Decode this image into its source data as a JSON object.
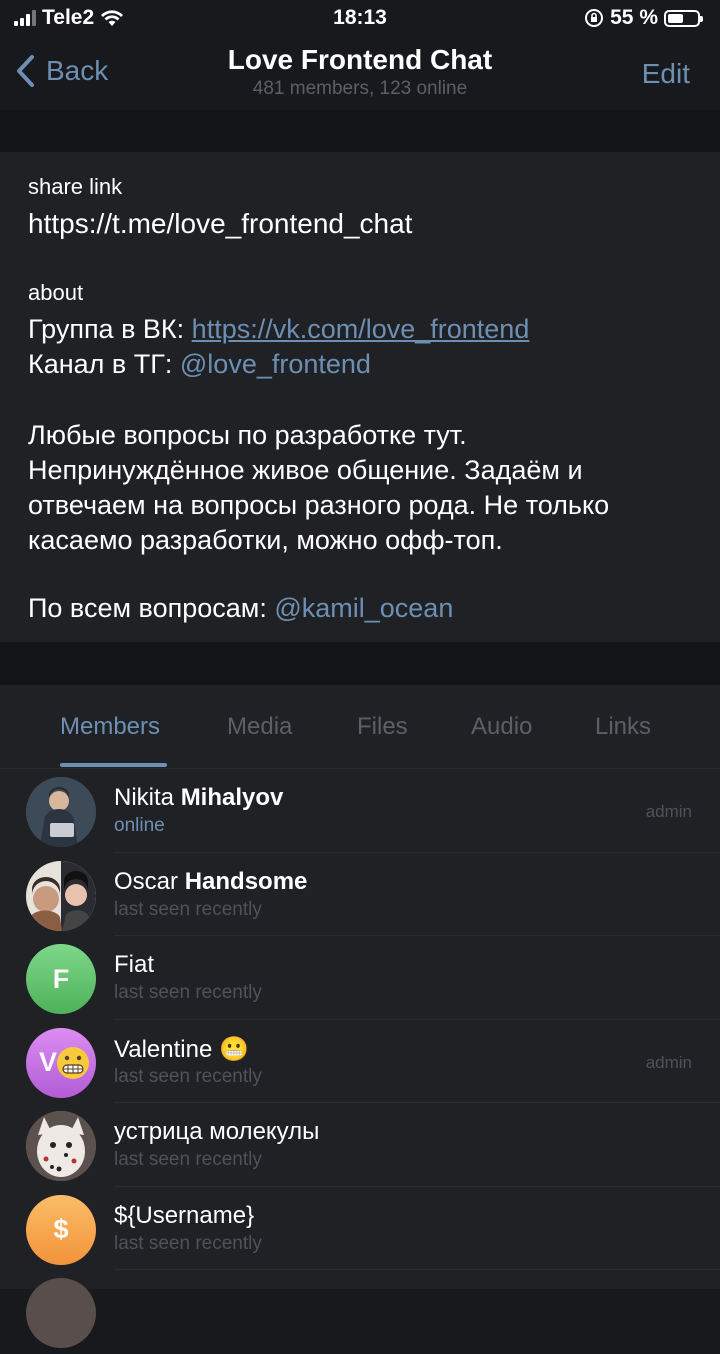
{
  "status_bar": {
    "carrier": "Tele2",
    "time": "18:13",
    "battery": "55 %",
    "battery_level": 0.55
  },
  "nav": {
    "back_label": "Back",
    "title": "Love Frontend Chat",
    "subtitle": "481 members, 123 online",
    "edit_label": "Edit"
  },
  "info": {
    "share_label": "share link",
    "share_url": "https://t.me/love_frontend_chat",
    "about_label": "about",
    "vk_prefix": "Группа в ВК: ",
    "vk_link": "https://vk.com/love_frontend",
    "tg_prefix": "Канал в ТГ: ",
    "tg_link": "@love_frontend",
    "desc_1": "Любые вопросы по разработке тут.",
    "desc_2": "Непринуждённое живое общение. Задаём и",
    "desc_3": "отвечаем на вопросы разного рода. Не только",
    "desc_4": "касаемо разработки, можно офф-топ.",
    "contact_prefix": "По всем вопросам: ",
    "contact_link": "@kamil_ocean"
  },
  "tabs": [
    "Members",
    "Media",
    "Files",
    "Audio",
    "Links"
  ],
  "members": [
    {
      "first": "Nikita",
      "last": "Mihalyov",
      "status": "online",
      "role": "admin",
      "avatar_letter": "",
      "avatar_color": "#4a5a6a"
    },
    {
      "first": "Oscar",
      "last": "Handsome",
      "status": "last seen recently",
      "role": "",
      "avatar_letter": "",
      "avatar_color": "#6a4e47"
    },
    {
      "first": "Fiat",
      "last": "",
      "status": "last seen recently",
      "role": "",
      "avatar_letter": "F",
      "avatar_color": "#62c46a"
    },
    {
      "first": "Valentine 😬",
      "last": "",
      "status": "last seen recently",
      "role": "admin",
      "avatar_letter": "V",
      "avatar_color": "#c36be3"
    },
    {
      "first": "устрица молекулы",
      "last": "",
      "status": "last seen recently",
      "role": "",
      "avatar_letter": "",
      "avatar_color": "#7b6f6a"
    },
    {
      "first": "${Username}",
      "last": "",
      "status": "last seen recently",
      "role": "",
      "avatar_letter": "$",
      "avatar_color": "#f5a34a"
    }
  ]
}
